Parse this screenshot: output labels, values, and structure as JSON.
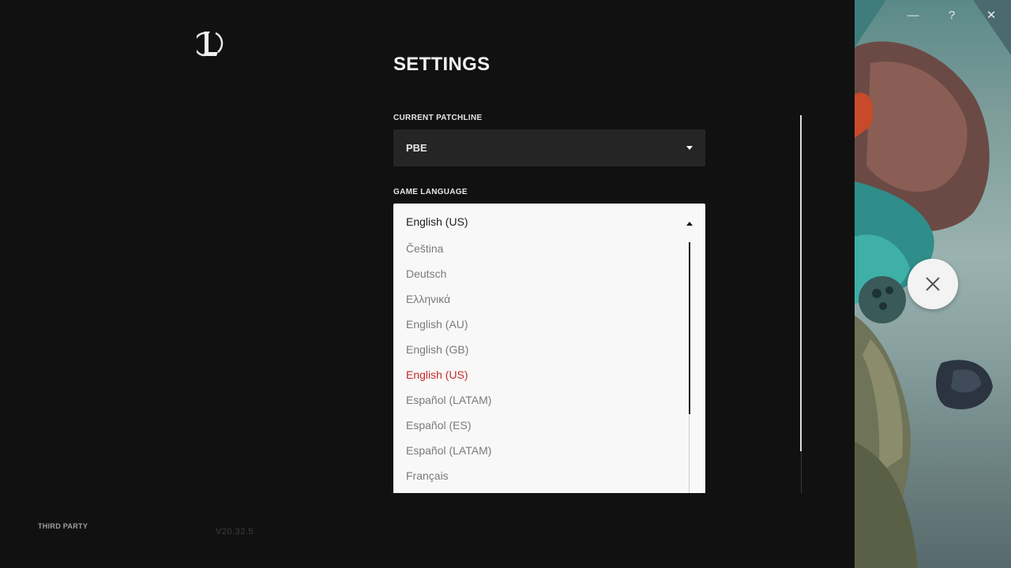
{
  "footer": {
    "third_party": "THIRD PARTY",
    "version": "V20.32.5"
  },
  "settings": {
    "title": "SETTINGS",
    "patchline": {
      "label": "CURRENT PATCHLINE",
      "value": "PBE"
    },
    "language": {
      "label": "GAME LANGUAGE",
      "value": "English (US)",
      "options": [
        "Čeština",
        "Deutsch",
        "Ελληνικά",
        "English (AU)",
        "English (GB)",
        "English (US)",
        "Español (LATAM)",
        "Español (ES)",
        "Español (LATAM)",
        "Français"
      ],
      "selected_index": 5
    }
  },
  "window_controls": {
    "minimize": "—",
    "help": "?",
    "close": "✕"
  },
  "colors": {
    "background": "#111111",
    "dropdown_dark": "#252525",
    "dropdown_light": "#f8f8f8",
    "selected_option": "#c8282b"
  },
  "icons": {
    "logo": "league-logo-icon",
    "close_overlay": "close-icon"
  }
}
